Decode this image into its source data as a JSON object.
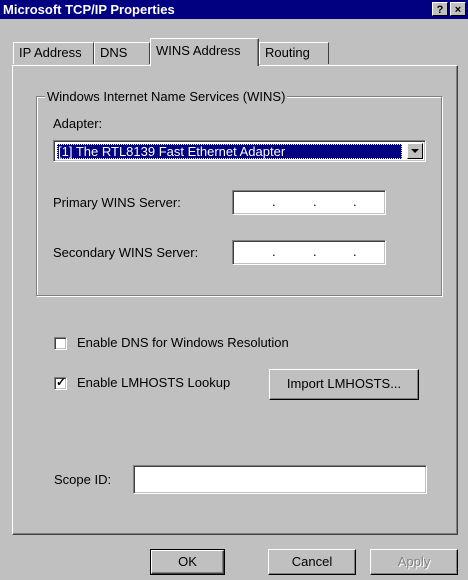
{
  "window": {
    "title": "Microsoft TCP/IP Properties",
    "help_button": "?",
    "close_button": "×"
  },
  "tabs": [
    {
      "label": "IP Address"
    },
    {
      "label": "DNS"
    },
    {
      "label": "WINS Address",
      "active": true
    },
    {
      "label": "Routing"
    }
  ],
  "wins": {
    "group_title": "Windows Internet Name Services (WINS)",
    "adapter_label": "Adapter:",
    "adapter_selected": "[1] The RTL8139 Fast Ethernet Adapter",
    "primary_label": "Primary WINS Server:",
    "secondary_label": "Secondary WINS Server:",
    "ip_dot": "."
  },
  "options": {
    "enable_dns_label": "Enable DNS for Windows Resolution",
    "enable_dns_checked": false,
    "enable_lmhosts_label": "Enable LMHOSTS Lookup",
    "enable_lmhosts_checked": true,
    "check_mark": "✓",
    "import_lmhosts_label": "Import LMHOSTS..."
  },
  "scope": {
    "label": "Scope ID:",
    "value": ""
  },
  "footer": {
    "ok_label": "OK",
    "cancel_label": "Cancel",
    "apply_label": "Apply"
  },
  "colors": {
    "title_bar": "#000080",
    "face": "#c0c0c0",
    "selection": "#000080"
  }
}
